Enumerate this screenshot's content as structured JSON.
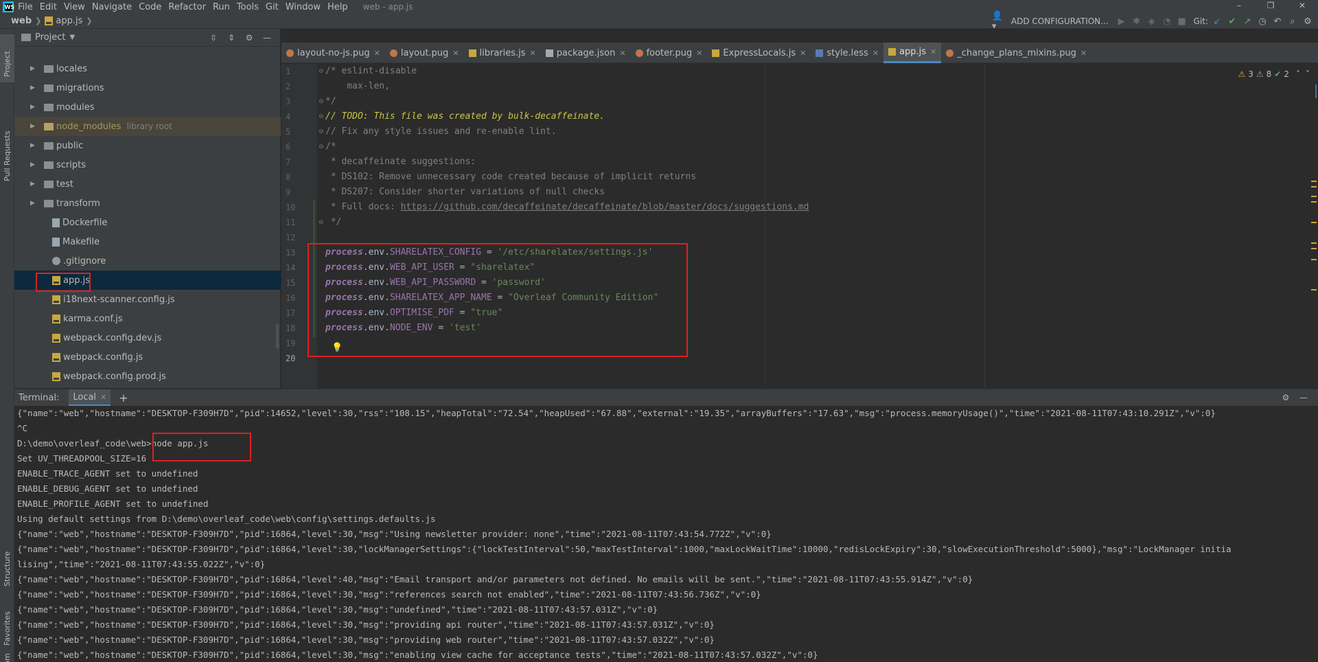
{
  "app": {
    "logo_text": "WS",
    "menus": [
      "File",
      "Edit",
      "View",
      "Navigate",
      "Code",
      "Refactor",
      "Run",
      "Tools",
      "Git",
      "Window",
      "Help"
    ],
    "window_title": "web - app.js",
    "window_controls": [
      "–",
      "❐",
      "✕"
    ]
  },
  "navbar": {
    "breadcrumb_root": "web",
    "breadcrumb_file": "app.js",
    "add_configuration": "ADD CONFIGURATION...",
    "git_label": "Git:"
  },
  "left_stripe": {
    "project_tab": "Project",
    "pull_requests_tab": "Pull Requests",
    "structure_tab": "Structure",
    "favorites_tab": "Favorites",
    "npm_tab": "npm"
  },
  "project_panel": {
    "title": "Project",
    "items": [
      {
        "label": "locales",
        "type": "folder"
      },
      {
        "label": "migrations",
        "type": "folder"
      },
      {
        "label": "modules",
        "type": "folder"
      },
      {
        "label": "node_modules",
        "type": "folder",
        "sub": "library root"
      },
      {
        "label": "public",
        "type": "folder"
      },
      {
        "label": "scripts",
        "type": "folder"
      },
      {
        "label": "test",
        "type": "folder"
      },
      {
        "label": "transform",
        "type": "folder"
      },
      {
        "label": "Dockerfile",
        "type": "file"
      },
      {
        "label": "Makefile",
        "type": "file"
      },
      {
        "label": ".gitignore",
        "type": "file"
      },
      {
        "label": "app.js",
        "type": "js"
      },
      {
        "label": "i18next-scanner.config.js",
        "type": "js"
      },
      {
        "label": "karma.conf.js",
        "type": "js"
      },
      {
        "label": "webpack.config.dev.js",
        "type": "js"
      },
      {
        "label": "webpack.config.js",
        "type": "js"
      },
      {
        "label": "webpack.config.prod.js",
        "type": "js"
      }
    ]
  },
  "editor_tabs": [
    {
      "label": "layout-no-js.pug",
      "kind": "pug"
    },
    {
      "label": "layout.pug",
      "kind": "pug"
    },
    {
      "label": "libraries.js",
      "kind": "js"
    },
    {
      "label": "package.json",
      "kind": "json"
    },
    {
      "label": "footer.pug",
      "kind": "pug"
    },
    {
      "label": "ExpressLocals.js",
      "kind": "js"
    },
    {
      "label": "style.less",
      "kind": "less"
    },
    {
      "label": "app.js",
      "kind": "js",
      "active": true
    },
    {
      "label": "_change_plans_mixins.pug",
      "kind": "pug"
    }
  ],
  "inspections": {
    "warnings": "3",
    "weak_warnings": "8",
    "ok": "2"
  },
  "code": {
    "l1": "/* eslint-disable",
    "l2": "    max-len,",
    "l3": "*/",
    "l4": "// TODO: This file was created by bulk-decaffeinate.",
    "l5": "// Fix any style issues and re-enable lint.",
    "l6": "/*",
    "l7": " * decaffeinate suggestions:",
    "l8": " * DS102: Remove unnecessary code created because of implicit returns",
    "l9": " * DS207: Consider shorter variations of null checks",
    "l10_prefix": " * Full docs: ",
    "l10_link": "https://github.com/decaffeinate/decaffeinate/blob/master/docs/suggestions.md",
    "l11": " */",
    "kw": "process",
    "env": ".env.",
    "eq": " = ",
    "v13_name": "SHARELATEX_CONFIG",
    "v13_val": "'/etc/sharelatex/settings.js'",
    "v14_name": "WEB_API_USER",
    "v14_val": "\"sharelatex\"",
    "v15_name": "WEB_API_PASSWORD",
    "v15_val": "'password'",
    "v16_name": "SHARELATEX_APP_NAME",
    "v16_val": "\"Overleaf Community Edition\"",
    "v17_name": "OPTIMISE_PDF",
    "v17_val": "\"true\"",
    "v18_name": "NODE_ENV",
    "v18_val": "'test'"
  },
  "terminal": {
    "title": "Terminal:",
    "tab": "Local",
    "lines": [
      "{\"name\":\"web\",\"hostname\":\"DESKTOP-F309H7D\",\"pid\":14652,\"level\":30,\"rss\":\"108.15\",\"heapTotal\":\"72.54\",\"heapUsed\":\"67.88\",\"external\":\"19.35\",\"arrayBuffers\":\"17.63\",\"msg\":\"process.memoryUsage()\",\"time\":\"2021-08-11T07:43:10.291Z\",\"v\":0}",
      "^C",
      "D:\\demo\\overleaf_code\\web>node app.js",
      "Set UV_THREADPOOL_SIZE=16",
      "ENABLE_TRACE_AGENT set to undefined",
      "ENABLE_DEBUG_AGENT set to undefined",
      "ENABLE_PROFILE_AGENT set to undefined",
      "Using default settings from D:\\demo\\overleaf_code\\web\\config\\settings.defaults.js",
      "{\"name\":\"web\",\"hostname\":\"DESKTOP-F309H7D\",\"pid\":16864,\"level\":30,\"msg\":\"Using newsletter provider: none\",\"time\":\"2021-08-11T07:43:54.772Z\",\"v\":0}",
      "{\"name\":\"web\",\"hostname\":\"DESKTOP-F309H7D\",\"pid\":16864,\"level\":30,\"lockManagerSettings\":{\"lockTestInterval\":50,\"maxTestInterval\":1000,\"maxLockWaitTime\":10000,\"redisLockExpiry\":30,\"slowExecutionThreshold\":5000},\"msg\":\"LockManager initia",
      "lising\",\"time\":\"2021-08-11T07:43:55.022Z\",\"v\":0}",
      "{\"name\":\"web\",\"hostname\":\"DESKTOP-F309H7D\",\"pid\":16864,\"level\":40,\"msg\":\"Email transport and/or parameters not defined. No emails will be sent.\",\"time\":\"2021-08-11T07:43:55.914Z\",\"v\":0}",
      "{\"name\":\"web\",\"hostname\":\"DESKTOP-F309H7D\",\"pid\":16864,\"level\":30,\"msg\":\"references search not enabled\",\"time\":\"2021-08-11T07:43:56.736Z\",\"v\":0}",
      "{\"name\":\"web\",\"hostname\":\"DESKTOP-F309H7D\",\"pid\":16864,\"level\":30,\"msg\":\"undefined\",\"time\":\"2021-08-11T07:43:57.031Z\",\"v\":0}",
      "{\"name\":\"web\",\"hostname\":\"DESKTOP-F309H7D\",\"pid\":16864,\"level\":30,\"msg\":\"providing api router\",\"time\":\"2021-08-11T07:43:57.031Z\",\"v\":0}",
      "{\"name\":\"web\",\"hostname\":\"DESKTOP-F309H7D\",\"pid\":16864,\"level\":30,\"msg\":\"providing web router\",\"time\":\"2021-08-11T07:43:57.032Z\",\"v\":0}",
      "{\"name\":\"web\",\"hostname\":\"DESKTOP-F309H7D\",\"pid\":16864,\"level\":30,\"msg\":\"enabling view cache for acceptance tests\",\"time\":\"2021-08-11T07:43:57.032Z\",\"v\":0}"
    ]
  },
  "colors": {
    "accent": "#4a88c7",
    "annotation": "#e02020",
    "selection": "#0d293e"
  }
}
